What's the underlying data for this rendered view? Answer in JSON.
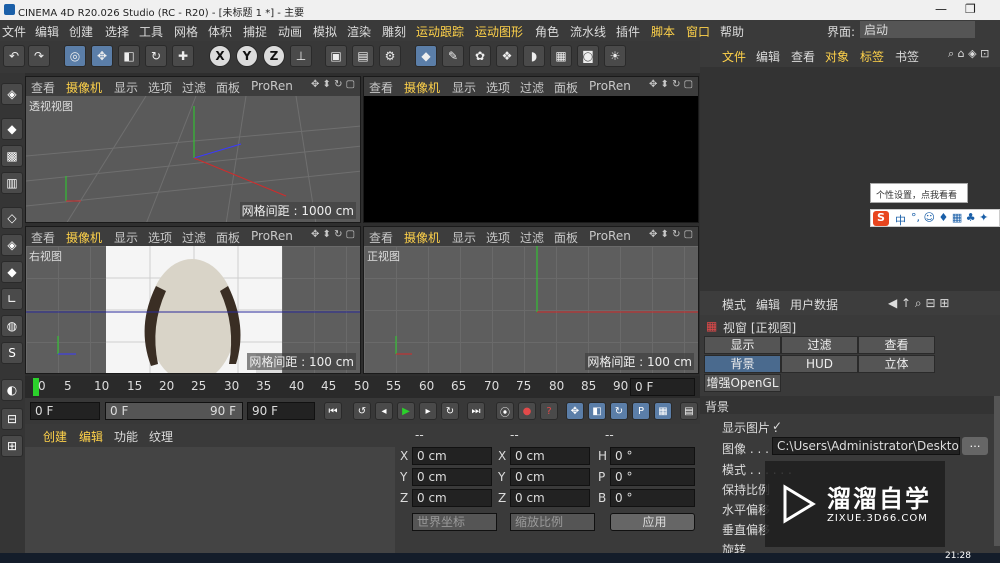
{
  "window": {
    "title": "CINEMA 4D R20.026 Studio (RC - R20) - [未标题 1 *] - 主要",
    "minimize": "—",
    "maximize": "❐"
  },
  "menu": [
    "文件",
    "编辑",
    "创建",
    "选择",
    "工具",
    "网格",
    "体积",
    "捕捉",
    "动画",
    "模拟",
    "渲染",
    "雕刻",
    "运动跟踪",
    "运动图形",
    "角色",
    "流水线",
    "插件",
    "脚本",
    "窗口",
    "帮助"
  ],
  "menu_highlight": [
    "运动跟踪",
    "运动图形",
    "脚本",
    "窗口"
  ],
  "interface": {
    "label": "界面:",
    "value": "启动"
  },
  "viewport_menu": [
    "查看",
    "摄像机",
    "显示",
    "选项",
    "过滤",
    "面板",
    "ProRen"
  ],
  "viewports": [
    {
      "label": "透视视图",
      "grid": "网格间距 : 1000 cm"
    },
    {
      "label": "",
      "grid": ""
    },
    {
      "label": "右视图",
      "grid": "网格间距 : 100 cm"
    },
    {
      "label": "正视图",
      "grid": "网格间距 : 100 cm"
    }
  ],
  "toolbar_axes": [
    "X",
    "Y",
    "Z"
  ],
  "timeline": {
    "ticks": [
      "0",
      "5",
      "10",
      "15",
      "20",
      "25",
      "30",
      "35",
      "40",
      "45",
      "50",
      "55",
      "60",
      "65",
      "70",
      "75",
      "80",
      "85",
      "90"
    ],
    "end_field": "0 F"
  },
  "playbar": {
    "start": "0 F",
    "range_start": "0 F",
    "range_end": "90 F",
    "end": "90 F"
  },
  "material_menu": [
    "创建",
    "编辑",
    "功能",
    "纹理"
  ],
  "coords": {
    "headers": [
      "--",
      "--",
      "--"
    ],
    "rows": [
      {
        "a": "X",
        "av": "0 cm",
        "b": "X",
        "bv": "0 cm",
        "c": "H",
        "cv": "0 °"
      },
      {
        "a": "Y",
        "av": "0 cm",
        "b": "Y",
        "bv": "0 cm",
        "c": "P",
        "cv": "0 °"
      },
      {
        "a": "Z",
        "av": "0 cm",
        "b": "Z",
        "bv": "0 cm",
        "c": "B",
        "cv": "0 °"
      }
    ],
    "world": "世界坐标",
    "scale": "缩放比例",
    "apply": "应用"
  },
  "object_menu": [
    "文件",
    "编辑",
    "查看",
    "对象",
    "标签",
    "书签"
  ],
  "ime": {
    "tooltip": "个性设置，点我看看",
    "mode": "中"
  },
  "attr_menu": [
    "模式",
    "编辑",
    "用户数据"
  ],
  "attr": {
    "title": "视窗 [正视图]",
    "tabs1": [
      "显示",
      "过滤",
      "查看"
    ],
    "tabs2": [
      "背景",
      "HUD",
      "立体"
    ],
    "tab3": "增强OpenGL",
    "section": "背景",
    "show_image_label": "显示图片 .",
    "show_image_check": "✓",
    "image_label": "图像 . . . . . .",
    "image_path": "C:\\Users\\Administrator\\Desktop",
    "mode_label": "模式 . . . . . .",
    "keep_ratio": "保持比例",
    "h_offset": "水平偏移",
    "v_offset": "垂直偏移",
    "rotate": "旋转"
  },
  "watermark": {
    "brand": "溜溜自学",
    "url": "ZIXUE.3D66.COM"
  },
  "taskbar": {
    "clock": "21:28"
  },
  "colors": {
    "menu_highlight": "#ffd24a",
    "accent": "#5b7ea8",
    "bg": "#2e2e2e"
  }
}
